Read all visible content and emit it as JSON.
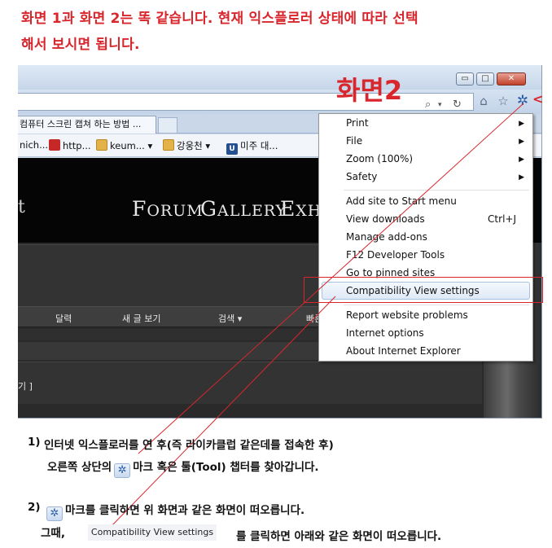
{
  "heading": {
    "line1": "화면 1과 화면 2는 똑 같습니다. 현재 익스플로러 상태에 따라 선택",
    "line2": "해서 보시면 됩니다."
  },
  "screenshot": {
    "label": "화면2",
    "window_buttons": {
      "minimize": "▭",
      "maximize": "□",
      "close": "✕"
    },
    "tab_title": "컴퓨터 스크린 캡쳐 하는 방법 ...",
    "favorites": [
      "nich...",
      "http...",
      "keum...",
      "강웅천",
      "미주 대..."
    ],
    "site_nav": {
      "left_fragment": "t",
      "forum": {
        "initial": "F",
        "rest": "ORUM"
      },
      "gallery": {
        "initial": "G",
        "rest": "ALLERY"
      },
      "exhib": {
        "initial": "E",
        "rest": "XHIB"
      }
    },
    "site_menu": [
      "달력",
      "새 글 보기",
      "검색 ▾",
      "빠른"
    ],
    "content_fragment": "기 ]",
    "tools_menu": {
      "print": "Print",
      "file": "File",
      "zoom": "Zoom (100%)",
      "safety": "Safety",
      "add_site": "Add site to Start menu",
      "view_downloads": "View downloads",
      "view_downloads_shortcut": "Ctrl+J",
      "manage_addons": "Manage add-ons",
      "f12": "F12 Developer Tools",
      "pinned_sites": "Go to pinned sites",
      "compat_view": "Compatibility View settings",
      "report_problems": "Report website problems",
      "internet_options": "Internet options",
      "about_ie": "About Internet Explorer"
    }
  },
  "instructions": {
    "step1_number": "1)",
    "step1_line1": "인터넷 익스플로러를 연 후(즉 라이카클럽 같은데를 접속한 후)",
    "step1_line2_a": "오른쪽 상단의",
    "step1_line2_b": "마크 혹은 툴(Tool) 챕터를 찾아갑니다.",
    "step2_number": "2)",
    "step2_line1": "마크를 클릭하면 위 화면과 같은 화면이 떠오릅니다.",
    "step2_then": "그때,",
    "step2_chip": "Compatibility View settings",
    "step2_rest": "를 클릭하면 아래와 같은 화면이 떠오릅니다."
  },
  "colors": {
    "accent_red": "#d8262c",
    "gear_blue": "#2d5fa8"
  }
}
